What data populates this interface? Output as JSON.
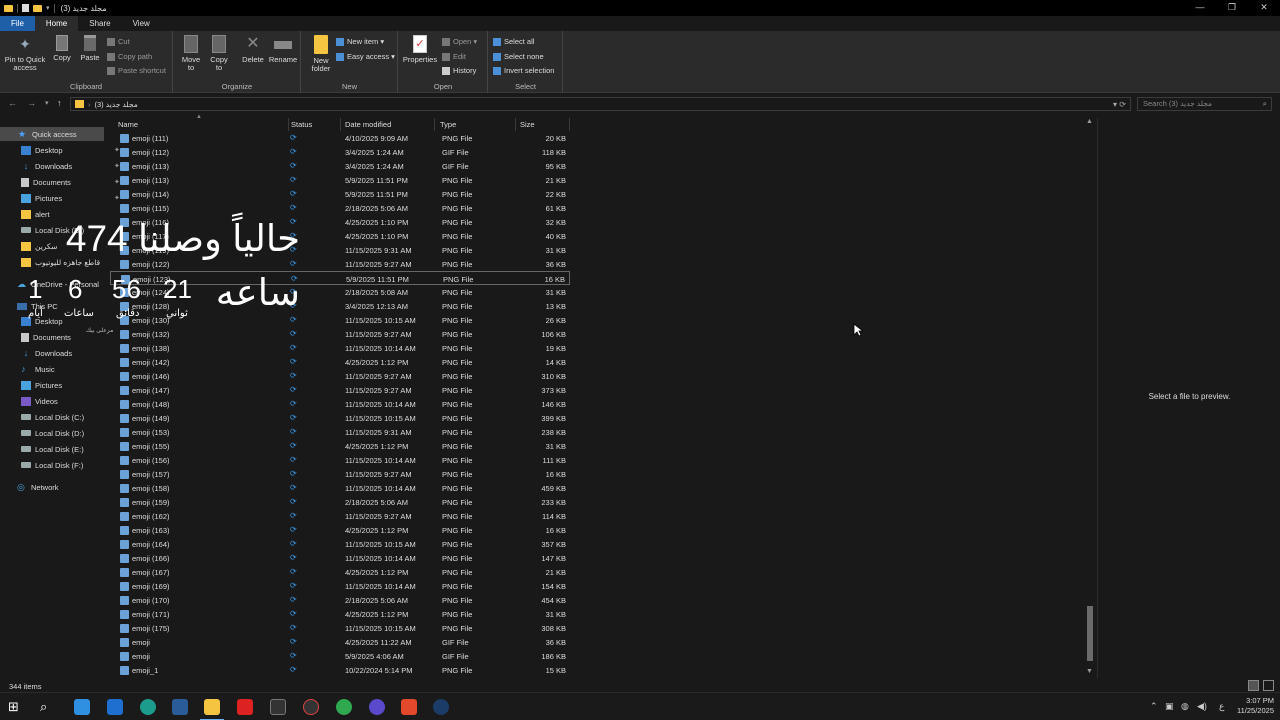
{
  "titlebar": {
    "title": "مجلد جديد (3)",
    "minimize": "—",
    "restore": "❐",
    "close": "✕"
  },
  "tabs": [
    "File",
    "Home",
    "Share",
    "View"
  ],
  "ribbon": {
    "clipboard": {
      "label": "Clipboard",
      "pin": "Pin to Quick access",
      "copy": "Copy",
      "paste": "Paste",
      "cut": "Cut",
      "copy_path": "Copy path",
      "paste_shortcut": "Paste shortcut"
    },
    "organize": {
      "label": "Organize",
      "move_to": "Move to",
      "copy_to": "Copy to",
      "delete": "Delete",
      "rename": "Rename"
    },
    "new": {
      "label": "New",
      "new_folder": "New folder",
      "new_item": "New item ▾",
      "easy_access": "Easy access ▾"
    },
    "open": {
      "label": "Open",
      "properties": "Properties",
      "open": "Open ▾",
      "edit": "Edit",
      "history": "History"
    },
    "select": {
      "label": "Select",
      "select_all": "Select all",
      "select_none": "Select none",
      "invert": "Invert selection"
    }
  },
  "address": {
    "path": "مجلد جديد (3)",
    "search_placeholder": "Search مجلد جديد (3)"
  },
  "nav": {
    "quick_access": "Quick access",
    "items": [
      {
        "label": "Desktop",
        "icon": "blue"
      },
      {
        "label": "Downloads",
        "icon": "dl"
      },
      {
        "label": "Documents",
        "icon": "doc"
      },
      {
        "label": "Pictures",
        "icon": "pic"
      },
      {
        "label": "alert",
        "icon": "fold"
      },
      {
        "label": "Local Disk (D:)",
        "icon": "disk"
      },
      {
        "label": "سكرين",
        "icon": "fold"
      },
      {
        "label": "قاطع جاهزه لليوتيوب",
        "icon": "fold"
      }
    ],
    "onedrive": "OneDrive - Personal",
    "this_pc": "This PC",
    "pc_items": [
      {
        "label": "Desktop",
        "icon": "blue"
      },
      {
        "label": "Documents",
        "icon": "doc"
      },
      {
        "label": "Downloads",
        "icon": "dl"
      },
      {
        "label": "Music",
        "icon": "music"
      },
      {
        "label": "Pictures",
        "icon": "pic"
      },
      {
        "label": "Videos",
        "icon": "vid"
      },
      {
        "label": "Local Disk (C:)",
        "icon": "disk"
      },
      {
        "label": "Local Disk (D:)",
        "icon": "disk"
      },
      {
        "label": "Local Disk (E:)",
        "icon": "disk"
      },
      {
        "label": "Local Disk (F:)",
        "icon": "disk"
      }
    ],
    "network": "Network"
  },
  "columns": {
    "name": "Name",
    "status": "Status",
    "date": "Date modified",
    "type": "Type",
    "size": "Size"
  },
  "files": [
    [
      "emoji (111)",
      "4/10/2025 9:09 AM",
      "PNG File",
      "20 KB"
    ],
    [
      "emoji (112)",
      "3/4/2025 1:24 AM",
      "GIF File",
      "118 KB"
    ],
    [
      "emoji (113)",
      "3/4/2025 1:24 AM",
      "GIF File",
      "95 KB"
    ],
    [
      "emoji (113)",
      "5/9/2025 11:51 PM",
      "PNG File",
      "21 KB"
    ],
    [
      "emoji (114)",
      "5/9/2025 11:51 PM",
      "PNG File",
      "22 KB"
    ],
    [
      "emoji (115)",
      "2/18/2025 5:06 AM",
      "PNG File",
      "61 KB"
    ],
    [
      "emoji (116)",
      "4/25/2025 1:10 PM",
      "PNG File",
      "32 KB"
    ],
    [
      "emoji (117)",
      "4/25/2025 1:10 PM",
      "PNG File",
      "40 KB"
    ],
    [
      "emoji (119)",
      "11/15/2025 9:31 AM",
      "PNG File",
      "31 KB"
    ],
    [
      "emoji (122)",
      "11/15/2025 9:27 AM",
      "PNG File",
      "36 KB"
    ],
    [
      "emoji (123)",
      "5/9/2025 11:51 PM",
      "PNG File",
      "16 KB"
    ],
    [
      "emoji (124)",
      "2/18/2025 5:08 AM",
      "PNG File",
      "31 KB"
    ],
    [
      "emoji (128)",
      "3/4/2025 12:13 AM",
      "PNG File",
      "13 KB"
    ],
    [
      "emoji (130)",
      "11/15/2025 10:15 AM",
      "PNG File",
      "26 KB"
    ],
    [
      "emoji (132)",
      "11/15/2025 9:27 AM",
      "PNG File",
      "106 KB"
    ],
    [
      "emoji (138)",
      "11/15/2025 10:14 AM",
      "PNG File",
      "19 KB"
    ],
    [
      "emoji (142)",
      "4/25/2025 1:12 PM",
      "PNG File",
      "14 KB"
    ],
    [
      "emoji (146)",
      "11/15/2025 9:27 AM",
      "PNG File",
      "310 KB"
    ],
    [
      "emoji (147)",
      "11/15/2025 9:27 AM",
      "PNG File",
      "373 KB"
    ],
    [
      "emoji (148)",
      "11/15/2025 10:14 AM",
      "PNG File",
      "146 KB"
    ],
    [
      "emoji (149)",
      "11/15/2025 10:15 AM",
      "PNG File",
      "399 KB"
    ],
    [
      "emoji (153)",
      "11/15/2025 9:31 AM",
      "PNG File",
      "238 KB"
    ],
    [
      "emoji (155)",
      "4/25/2025 1:12 PM",
      "PNG File",
      "31 KB"
    ],
    [
      "emoji (156)",
      "11/15/2025 10:14 AM",
      "PNG File",
      "111 KB"
    ],
    [
      "emoji (157)",
      "11/15/2025 9:27 AM",
      "PNG File",
      "16 KB"
    ],
    [
      "emoji (158)",
      "11/15/2025 10:14 AM",
      "PNG File",
      "459 KB"
    ],
    [
      "emoji (159)",
      "2/18/2025 5:06 AM",
      "PNG File",
      "233 KB"
    ],
    [
      "emoji (162)",
      "11/15/2025 9:27 AM",
      "PNG File",
      "114 KB"
    ],
    [
      "emoji (163)",
      "4/25/2025 1:12 PM",
      "PNG File",
      "16 KB"
    ],
    [
      "emoji (164)",
      "11/15/2025 10:15 AM",
      "PNG File",
      "357 KB"
    ],
    [
      "emoji (166)",
      "11/15/2025 10:14 AM",
      "PNG File",
      "147 KB"
    ],
    [
      "emoji (167)",
      "4/25/2025 1:12 PM",
      "PNG File",
      "21 KB"
    ],
    [
      "emoji (169)",
      "11/15/2025 10:14 AM",
      "PNG File",
      "154 KB"
    ],
    [
      "emoji (170)",
      "2/18/2025 5:06 AM",
      "PNG File",
      "454 KB"
    ],
    [
      "emoji (171)",
      "4/25/2025 1:12 PM",
      "PNG File",
      "31 KB"
    ],
    [
      "emoji (175)",
      "11/15/2025 10:15 AM",
      "PNG File",
      "308 KB"
    ],
    [
      "emoji",
      "4/25/2025 11:22 AM",
      "GIF File",
      "36 KB"
    ],
    [
      "emoji",
      "5/9/2025 4:06 AM",
      "GIF File",
      "186 KB"
    ],
    [
      "emoji_1",
      "10/22/2024 5:14 PM",
      "PNG File",
      "15 KB"
    ]
  ],
  "highlighted_row": 10,
  "preview_text": "Select a file to preview.",
  "overlay": {
    "headline": "حالياً وصلنا 474 ساعه",
    "days_value": "1",
    "hours_value": "6",
    "minutes_value": "56",
    "seconds_value": "21",
    "days_label": "أيام",
    "hours_label": "ساعات",
    "minutes_label": "دقائق",
    "seconds_label": "ثواني",
    "footer": "مرعلى بيك"
  },
  "status": {
    "count": "344 items"
  },
  "clock": {
    "time": "3:07 PM",
    "date": "11/25/2025"
  },
  "tray_lang": "ع",
  "colors": {
    "accent": "#1f5fa8",
    "folder": "#f5c542",
    "sync": "#3a9cf0"
  }
}
